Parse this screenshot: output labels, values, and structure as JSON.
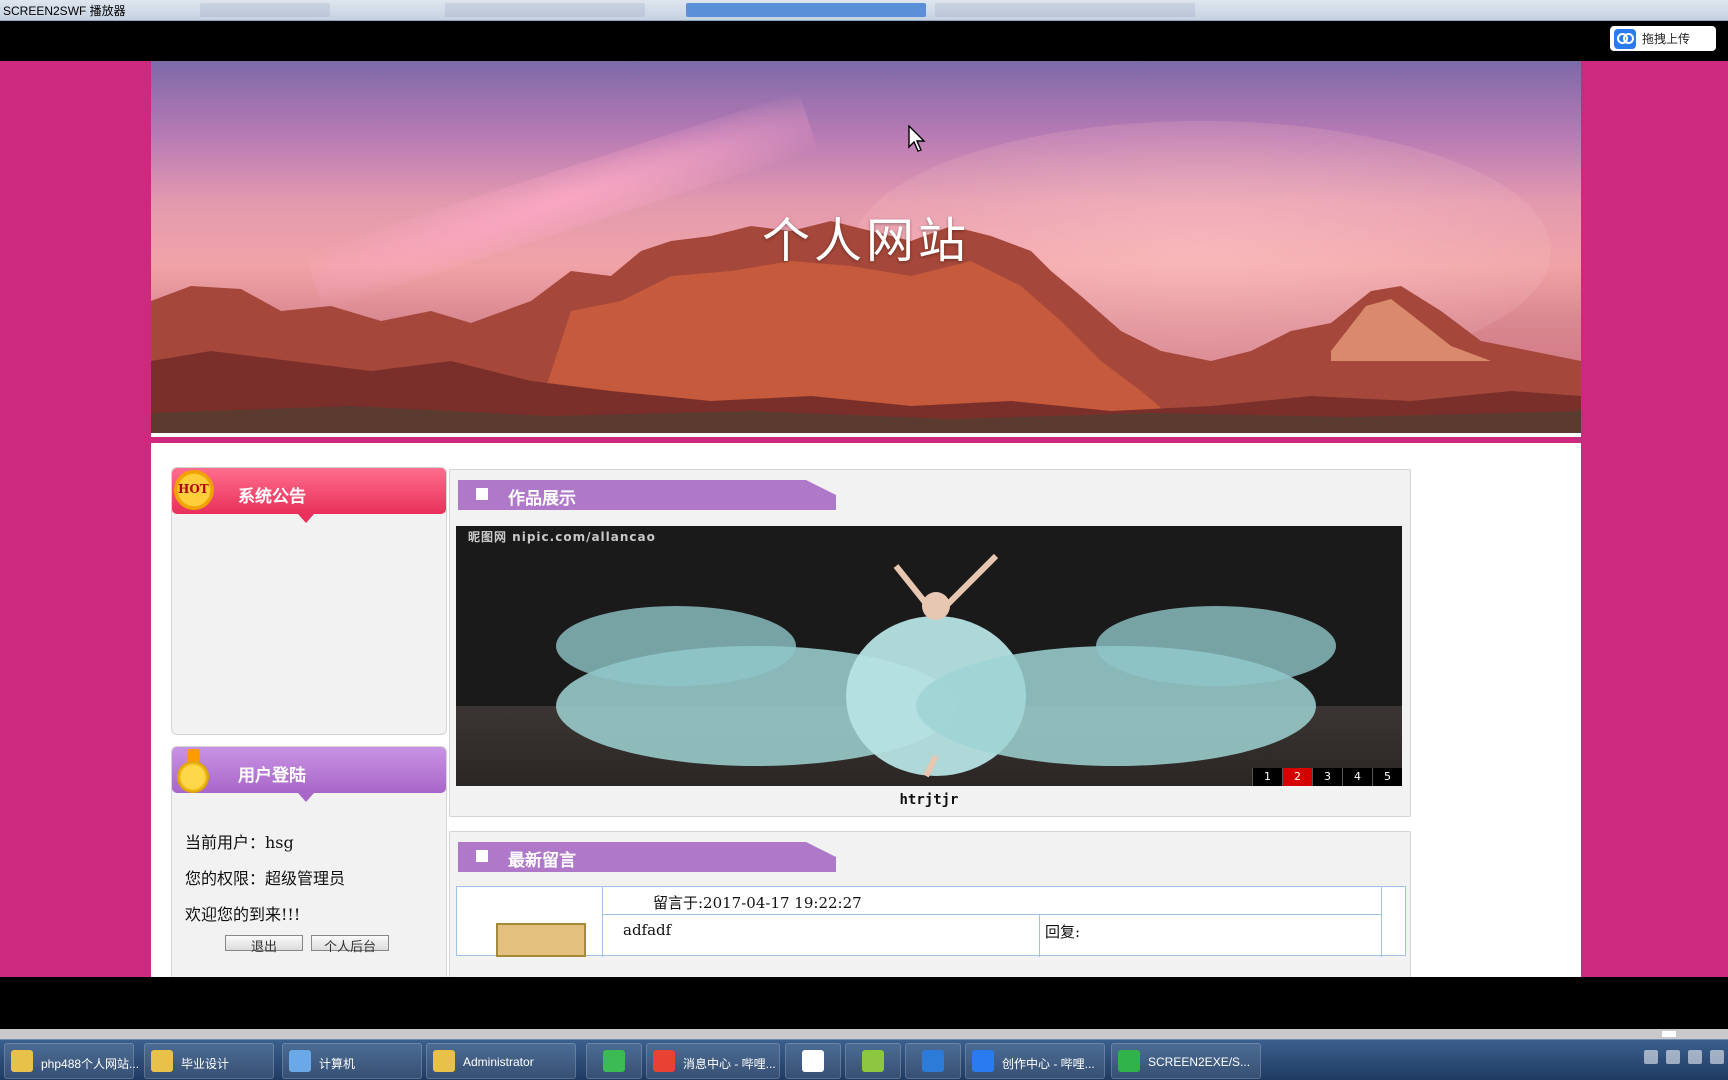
{
  "window": {
    "title": "SCREEN2SWF 播放器"
  },
  "upload_button": {
    "label": "拖拽上传"
  },
  "site": {
    "title": "个人网站",
    "notice_panel": {
      "badge": "HOT",
      "title": "系统公告"
    },
    "login_panel": {
      "title": "用户登陆",
      "current_user": "当前用户：hsg",
      "permission": "您的权限：超级管理员",
      "welcome": "欢迎您的到来!!!",
      "logout_label": "退出",
      "backend_label": "个人后台"
    },
    "works_section": {
      "title": "作品展示",
      "watermark": "昵图网 nipic.com/allancao",
      "caption": "htrjtjr",
      "pages": [
        "1",
        "2",
        "3",
        "4",
        "5"
      ],
      "active_page": "2"
    },
    "messages_section": {
      "title": "最新留言",
      "posted_at": "留言于:2017-04-17 19:22:27",
      "content": "adfadf",
      "reply_label": "回复:"
    }
  },
  "taskbar": {
    "items": [
      {
        "label": "php488个人网站...",
        "color": "#e8c14a"
      },
      {
        "label": "毕业设计",
        "color": "#e8c14a"
      },
      {
        "label": "计算机",
        "color": "#6aa8e8"
      },
      {
        "label": "Administrator",
        "color": "#e8c14a"
      },
      {
        "label": "",
        "color": "#3cba54"
      },
      {
        "label": "消息中心 - 哔哩...",
        "color": "#e94235"
      },
      {
        "label": "",
        "color": "#ffffff"
      },
      {
        "label": "",
        "color": "#8dc63f"
      },
      {
        "label": "",
        "color": "#2d7bd8"
      },
      {
        "label": "创作中心 - 哔哩...",
        "color": "#2a7bf0"
      },
      {
        "label": "SCREEN2EXE/S...",
        "color": "#2fb34a"
      }
    ]
  },
  "colors": {
    "background": "#cd2a7f",
    "panel_purple": "#b078c9",
    "notice_red": "#e8305a"
  }
}
